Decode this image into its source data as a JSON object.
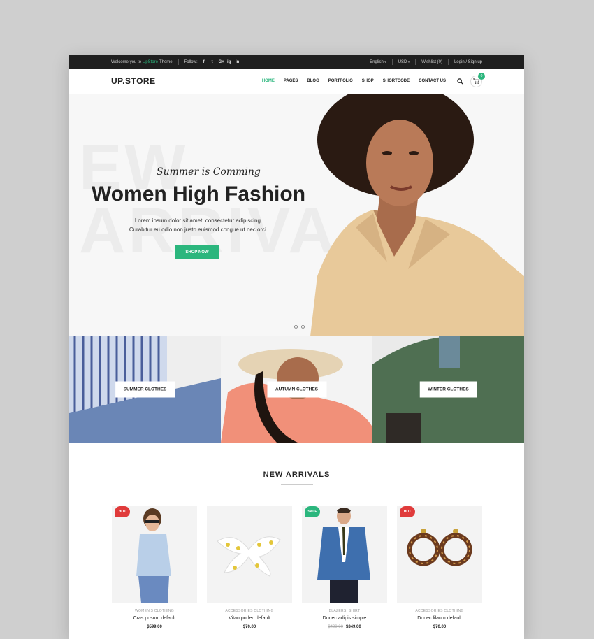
{
  "topbar": {
    "welcome_prefix": "Welcome you to",
    "welcome_brand": "UpStore",
    "welcome_suffix": "Theme",
    "follow_label": "Follow:",
    "social": [
      "f",
      "t",
      "G+",
      "ig",
      "in"
    ],
    "language": "English",
    "currency": "USD",
    "wishlist": "Wishlist (0)",
    "login": "Login / Sign up"
  },
  "header": {
    "logo": "UP.STORE",
    "nav": [
      "HOME",
      "PAGES",
      "BLOG",
      "PORTFOLIO",
      "SHOP",
      "SHORTCODE",
      "CONTACT US"
    ],
    "cart_count": "0"
  },
  "hero": {
    "bg_text_1": "EW",
    "bg_text_2": "ARRIVA",
    "tagline": "Summer is Comming",
    "title": "Women High Fashion",
    "desc_line1": "Lorem ipsum dolor sit amet, consectetur adipiscing.",
    "desc_line2": "Curabitur eu odio non justo euismod congue ut nec orci.",
    "button": "SHOP NOW"
  },
  "categories": [
    "SUMMER CLOTHES",
    "AUTUMN CLOTHES",
    "WINTER CLOTHES"
  ],
  "arrivals": {
    "title": "NEW ARRIVALS",
    "products": [
      {
        "tag": "HOT",
        "category": "WOMEN'S CLOTHING",
        "name": "Cras posum default",
        "old_price": "",
        "price": "$599.00"
      },
      {
        "tag": "",
        "category": "ACCESSORIES CLOTHING",
        "name": "Vitan porlec default",
        "old_price": "",
        "price": "$70.00"
      },
      {
        "tag": "SALE",
        "category": "BLAZERS, SHIRT",
        "name": "Donec adipis simple",
        "old_price": "$400.00",
        "price": "$349.00"
      },
      {
        "tag": "HOT",
        "category": "ACCESSORIES CLOTHING",
        "name": "Donec lilaum default",
        "old_price": "",
        "price": "$70.00"
      }
    ]
  },
  "colors": {
    "accent": "#2bb67d",
    "hot": "#e03b3b",
    "topbar": "#1f1f1f"
  }
}
